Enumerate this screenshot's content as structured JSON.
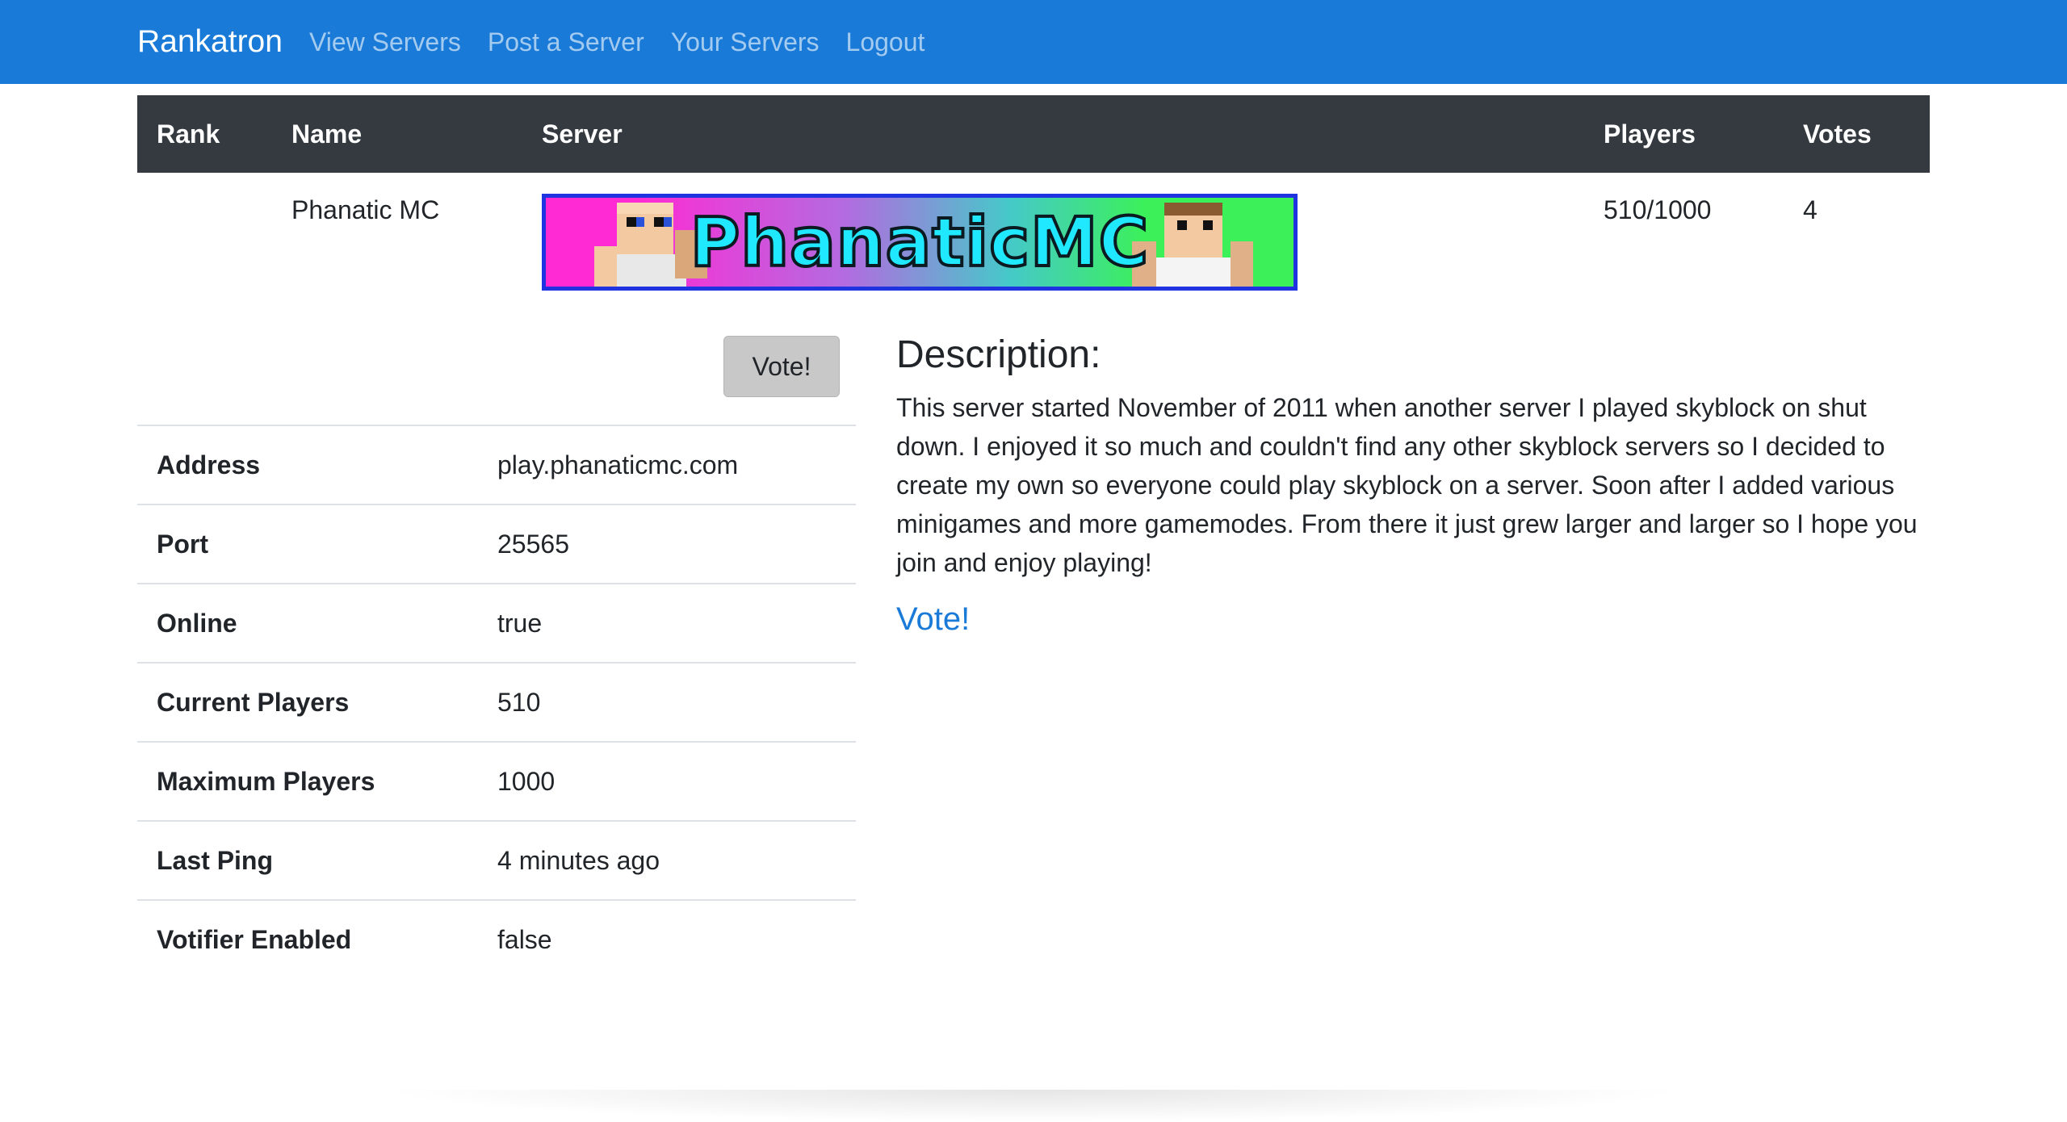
{
  "navbar": {
    "brand": "Rankatron",
    "links": [
      "View Servers",
      "Post a Server",
      "Your Servers",
      "Logout"
    ]
  },
  "table": {
    "headers": [
      "Rank",
      "Name",
      "Server",
      "Players",
      "Votes"
    ],
    "row": {
      "rank": "",
      "name": "Phanatic MC",
      "banner_text": "PhanaticMC",
      "players": "510/1000",
      "votes": "4"
    }
  },
  "vote_button_label": "Vote!",
  "details": [
    {
      "key": "Address",
      "value": "play.phanaticmc.com"
    },
    {
      "key": "Port",
      "value": "25565"
    },
    {
      "key": "Online",
      "value": "true"
    },
    {
      "key": "Current Players",
      "value": "510"
    },
    {
      "key": "Maximum Players",
      "value": "1000"
    },
    {
      "key": "Last Ping",
      "value": "4 minutes ago"
    },
    {
      "key": "Votifier Enabled",
      "value": "false"
    }
  ],
  "description": {
    "title": "Description:",
    "text": "This server started November of 2011 when another server I played skyblock on shut down. I enjoyed it so much and couldn't find any other skyblock servers so I decided to create my own so everyone could play skyblock on a server. Soon after I added various minigames and more gamemodes. From there it just grew larger and larger so I hope you join and enjoy playing!",
    "vote_link": "Vote!"
  },
  "colors": {
    "navbar": "#1a7ad8",
    "table_header": "#343a40",
    "link": "#1a7ad8",
    "banner_border": "#1f33e0"
  }
}
